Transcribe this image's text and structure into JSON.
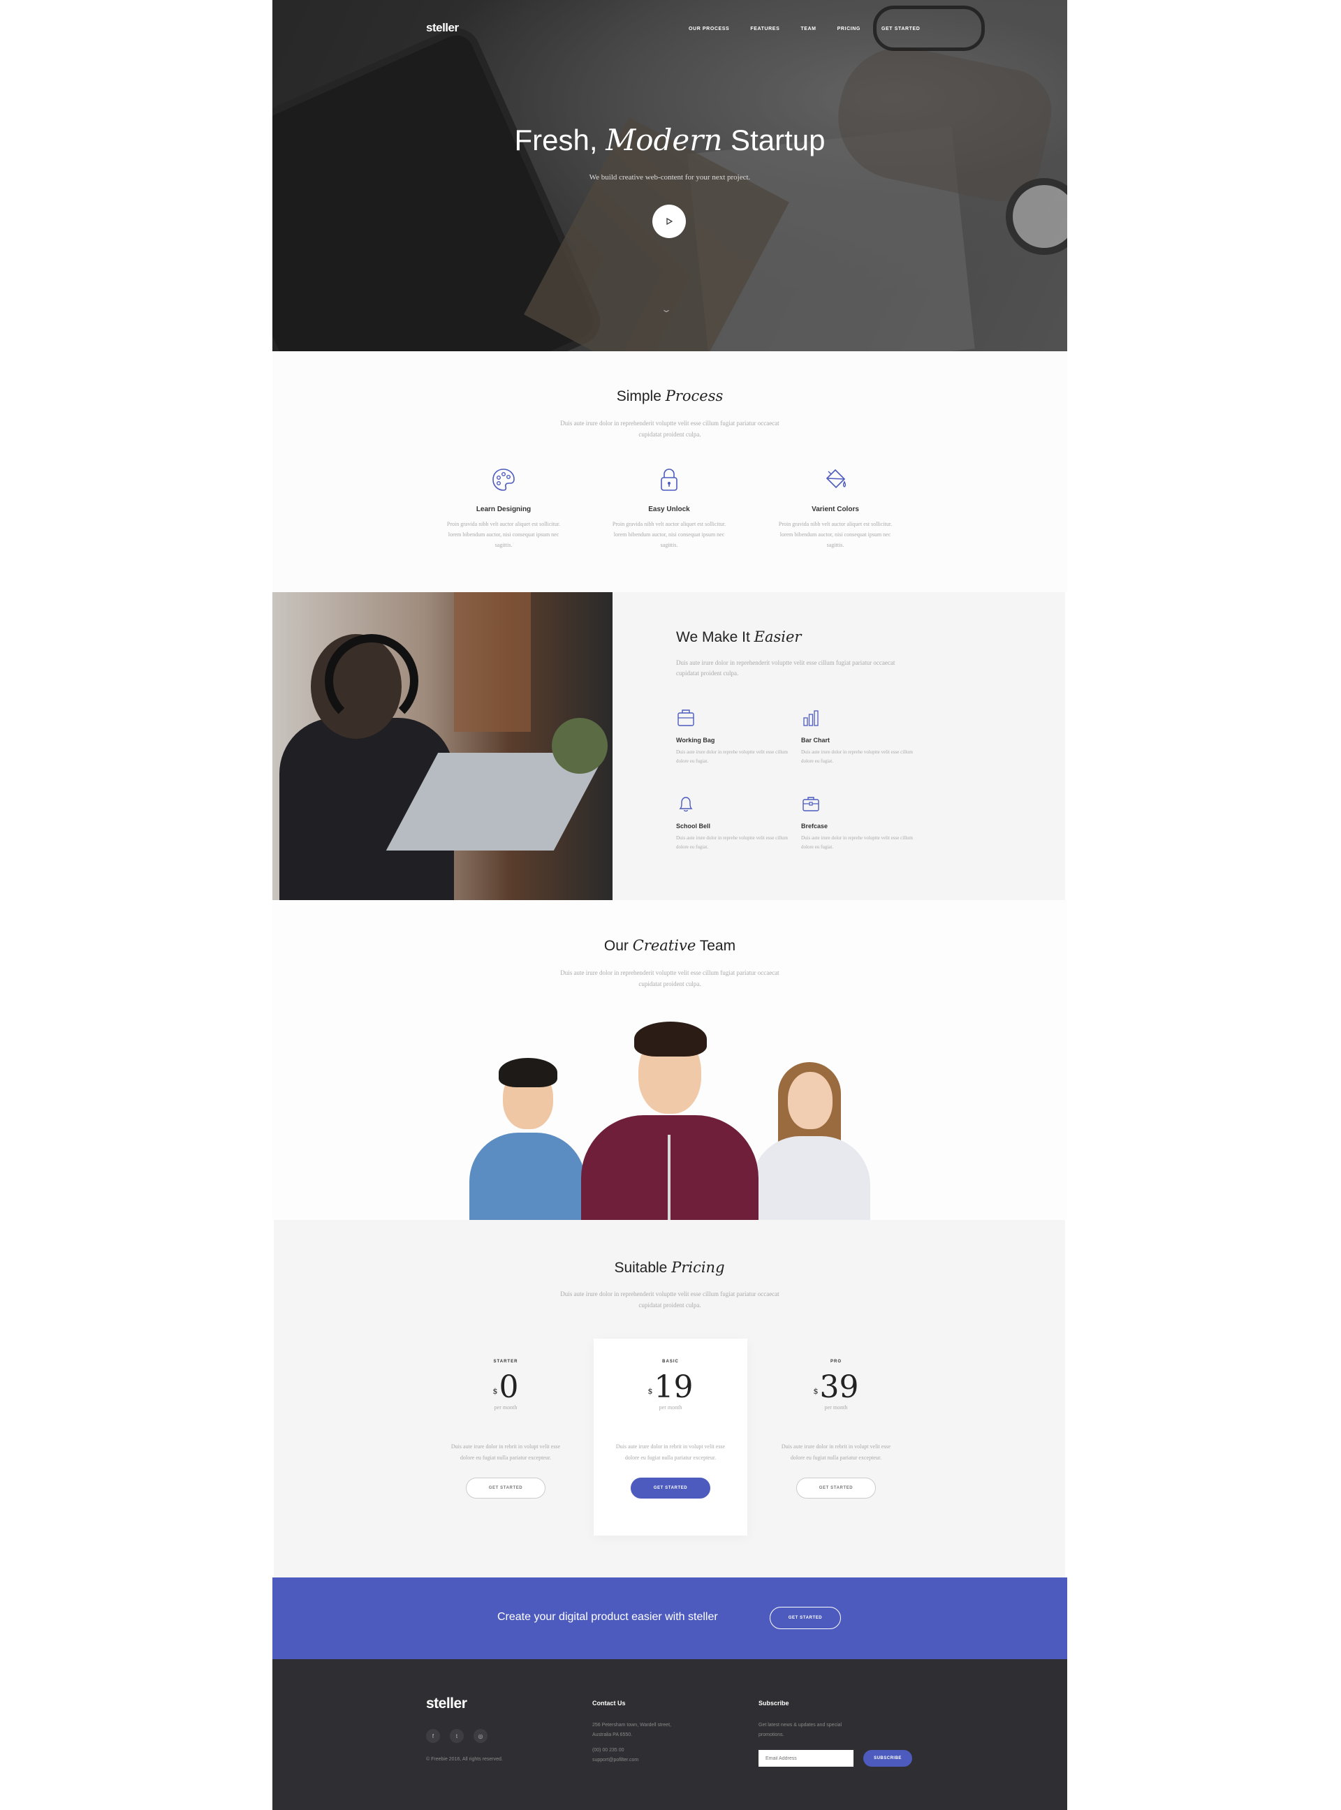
{
  "nav": {
    "logo": "steller",
    "items": [
      "OUR PROCESS",
      "FEATURES",
      "TEAM",
      "PRICING",
      "GET STARTED"
    ]
  },
  "hero": {
    "title_plain_1": "Fresh, ",
    "title_italic": "Modern",
    "title_plain_2": " Startup",
    "subtitle": "We build creative web-content for your next project."
  },
  "process": {
    "title_plain": "Simple ",
    "title_italic": "Process",
    "description": "Duis aute irure dolor in reprehenderit voluptte velit esse cillum fugiat pariatur occaecat cupidatat proident culpa.",
    "features": [
      {
        "icon": "palette-icon",
        "title": "Learn Designing",
        "text": "Proin gravida nibh velt auctor aliquet est sollicitur. lorem bibendum auctor, nisi consequat ipsum nec sagittis."
      },
      {
        "icon": "lock-icon",
        "title": "Easy Unlock",
        "text": "Proin gravida nibh velt auctor aliquet est sollicitur. lorem bibendum auctor, nisi consequat ipsum nec sagittis."
      },
      {
        "icon": "paint-bucket-icon",
        "title": "Varient Colors",
        "text": "Proin gravida nibh velt auctor aliquet est sollicitur. lorem bibendum auctor, nisi consequat ipsum nec sagittis."
      }
    ]
  },
  "easier": {
    "title_plain": "We Make It ",
    "title_italic": "Easier",
    "description": "Duis aute irure dolor in reprehenderit voluptte velit esse cillum fugiat pariatur occaecat cupidatat proident culpa.",
    "items": [
      {
        "icon": "working-bag-icon",
        "title": "Working Bag",
        "text": "Duis aute irure dolor in reprehe voluptte velit esse cillum dolore eu fugiat."
      },
      {
        "icon": "bar-chart-icon",
        "title": "Bar Chart",
        "text": "Duis aute irure dolor in reprehe voluptte velit esse cillum dolore eu fugiat."
      },
      {
        "icon": "school-bell-icon",
        "title": "School Bell",
        "text": "Duis aute irure dolor in reprehe voluptte velit esse cillum dolore eu fugiat."
      },
      {
        "icon": "briefcase-icon",
        "title": "Brefcase",
        "text": "Duis aute irure dolor in reprehe voluptte velit esse cillum dolore eu fugiat."
      }
    ]
  },
  "team": {
    "title_plain_1": "Our ",
    "title_italic": "Creative",
    "title_plain_2": " Team",
    "description": "Duis aute irure dolor in reprehenderit voluptte velit esse cillum fugiat pariatur occaecat cupidatat proident culpa."
  },
  "pricing": {
    "title_plain": "Suitable ",
    "title_italic": "Pricing",
    "description": "Duis aute irure dolor in reprehenderit voluptte velit esse cillum fugiat pariatur occaecat cupidatat proident culpa.",
    "currency": "$",
    "plans": [
      {
        "name": "STARTER",
        "price": "0",
        "period": "per month",
        "text": "Duis aute irure dolor in rebrit in volupt velit esse dolore eu fugiat nulla pariatur excepteur.",
        "button": "GET STARTED"
      },
      {
        "name": "BASIC",
        "price": "19",
        "period": "per month",
        "text": "Duis aute irure dolor in rebrit in volupt velit esse dolore eu fugiat nulla pariatur excepteur.",
        "button": "GET STARTED"
      },
      {
        "name": "PRO",
        "price": "39",
        "period": "per month",
        "text": "Duis aute irure dolor in rebrit in volupt velit esse dolore eu fugiat nulla pariatur excepteur.",
        "button": "GET STARTED"
      }
    ]
  },
  "cta": {
    "text": "Create your digital product easier with steller",
    "button": "GET STARTED"
  },
  "footer": {
    "logo": "steller",
    "social_icons": [
      "facebook-icon",
      "twitter-icon",
      "instagram-icon"
    ],
    "social_glyphs": [
      "f",
      "t",
      "◎"
    ],
    "copyright": "© Freebie 2016, All rights reserved.",
    "contact_title": "Contact Us",
    "address": "256 Petersham town, Wardell street, Australia PA 6550.",
    "phone": "(00) 00 235 00",
    "email": "support@pofilter.com",
    "subscribe_title": "Subscribe",
    "subscribe_text": "Get latest news & updates and special promotions.",
    "email_placeholder": "Email Address",
    "subscribe_button": "SUBSCRIBE"
  },
  "colors": {
    "accent": "#4d5bbf",
    "footer_bg": "#2f2f33",
    "section_bg": "#f5f5f5"
  }
}
